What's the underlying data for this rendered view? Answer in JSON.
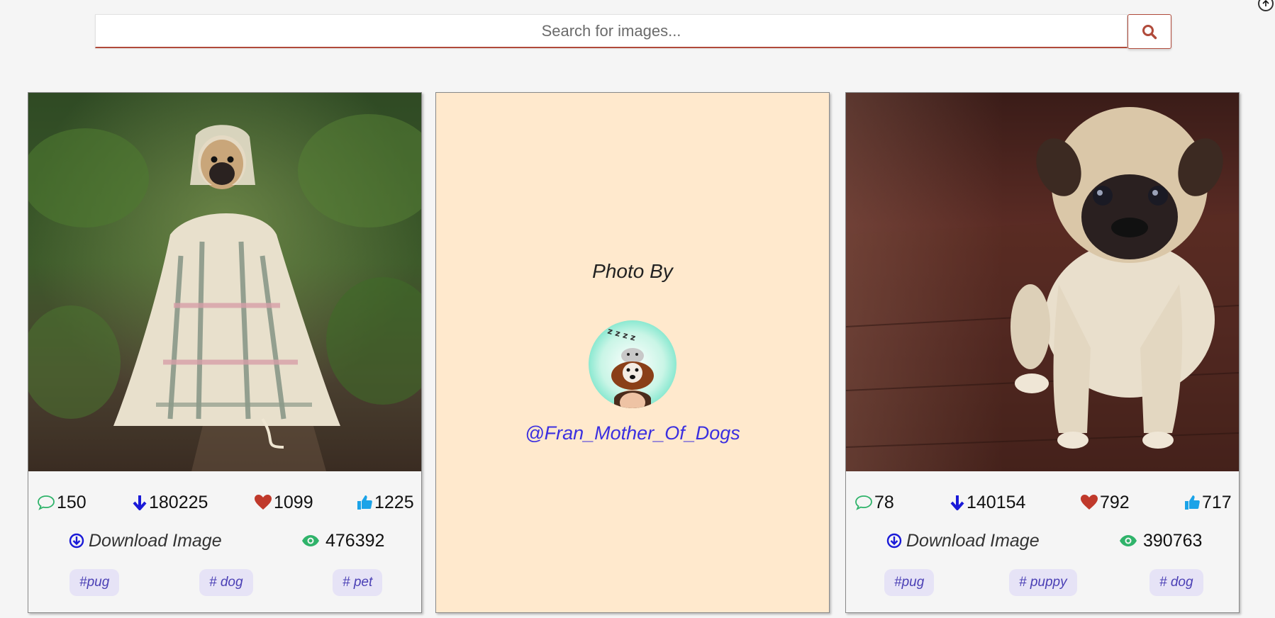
{
  "search": {
    "placeholder": "Search for images..."
  },
  "cards": [
    {
      "comments": "150",
      "downloads": "180225",
      "likes": "1099",
      "thumbs": "1225",
      "download_label": "Download Image",
      "views": "476392",
      "tags": [
        "#pug",
        "# dog",
        "# pet"
      ]
    },
    {
      "photo_by": "Photo By",
      "handle": "@Fran_Mother_Of_Dogs"
    },
    {
      "comments": "78",
      "downloads": "140154",
      "likes": "792",
      "thumbs": "717",
      "download_label": "Download Image",
      "views": "390763",
      "tags": [
        "#pug",
        "# puppy",
        "# dog"
      ]
    }
  ],
  "colors": {
    "accent": "#b04a3a",
    "comment": "#2fb36a",
    "download": "#1a1ad8",
    "heart": "#c0392b",
    "thumb": "#1ba3e8",
    "tag_bg": "#e6e3f6",
    "tag_text": "#4a3fb5",
    "photographer_bg": "#ffe9cd"
  }
}
